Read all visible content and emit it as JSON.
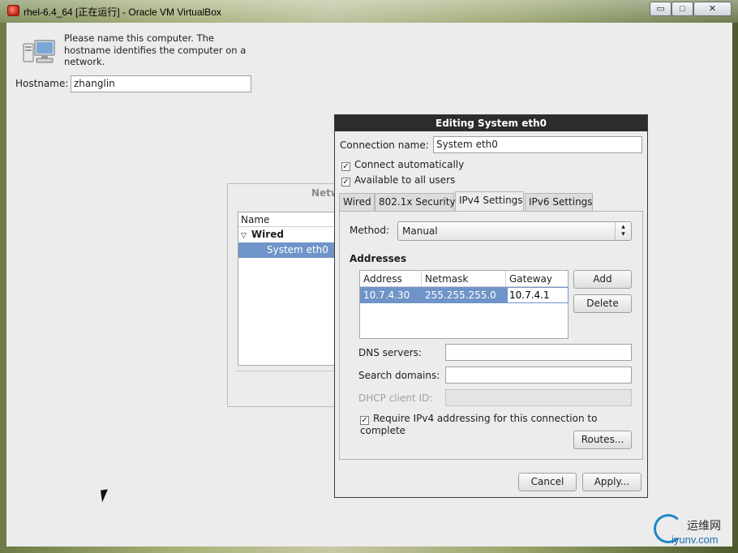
{
  "window": {
    "title": "rhel-6.4_64 [正在运行] - Oracle VM VirtualBox",
    "minimize_glyph": "▭",
    "maximize_glyph": "□",
    "close_glyph": "✕"
  },
  "hostname_screen": {
    "description": "Please name this computer.  The hostname identifies the computer on a network.",
    "label": "Hostname:",
    "value": "zhanglin"
  },
  "network_connections": {
    "title": "Netw",
    "column_name": "Name",
    "group": "Wired",
    "group_expander": "▽",
    "items": [
      "System eth0"
    ]
  },
  "editing_dialog": {
    "title": "Editing System eth0",
    "connection_name_label": "Connection name:",
    "connection_name_value": "System eth0",
    "connect_automatically": {
      "label": "Connect automatically",
      "checked": true
    },
    "available_to_all_users": {
      "label": "Available to all users",
      "checked": true
    },
    "tabs": [
      "Wired",
      "802.1x Security",
      "IPv4 Settings",
      "IPv6 Settings"
    ],
    "active_tab": "IPv4 Settings",
    "method_label": "Method:",
    "method_value": "Manual",
    "addresses_heading": "Addresses",
    "address_columns": [
      "Address",
      "Netmask",
      "Gateway"
    ],
    "address_rows": [
      {
        "address": "10.7.4.30",
        "netmask": "255.255.255.0",
        "gateway": "10.7.4.1"
      }
    ],
    "add_button": "Add",
    "delete_button": "Delete",
    "dns_servers_label": "DNS servers:",
    "dns_servers_value": "",
    "search_domains_label": "Search domains:",
    "search_domains_value": "",
    "dhcp_client_id_label": "DHCP client ID:",
    "dhcp_client_id_value": "",
    "require_ipv4": {
      "label": "Require IPv4 addressing for this connection to complete",
      "checked": true
    },
    "routes_button": "Routes...",
    "cancel_button": "Cancel",
    "apply_button": "Apply..."
  },
  "watermark": {
    "cn": "运维网",
    "en": "iyunv.com"
  },
  "colors": {
    "selection": "#6f94c8",
    "dialog_titlebar": "#2c2c2c",
    "panel_bg": "#ececec"
  }
}
